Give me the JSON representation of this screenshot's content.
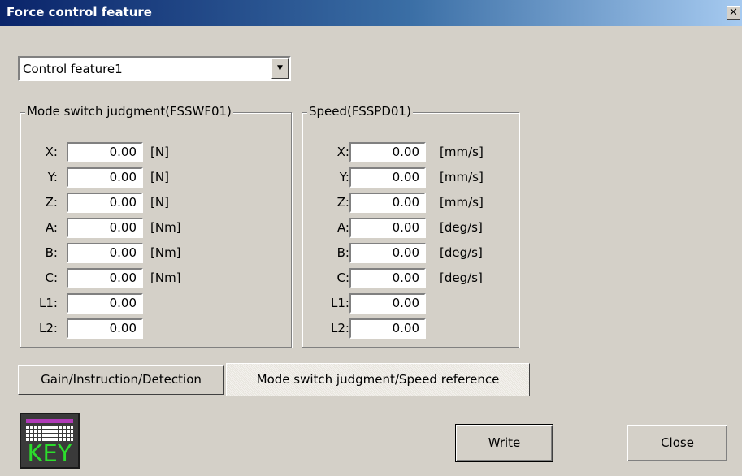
{
  "window": {
    "title": "Force control feature",
    "close_glyph": "✕"
  },
  "selector": {
    "value": "Control feature1",
    "arrow_icon": "▼"
  },
  "groups": {
    "mode_switch": {
      "title": "Mode switch judgment(FSSWF01)",
      "rows": [
        {
          "label": "X:",
          "value": "0.00",
          "unit": "[N]"
        },
        {
          "label": "Y:",
          "value": "0.00",
          "unit": "[N]"
        },
        {
          "label": "Z:",
          "value": "0.00",
          "unit": "[N]"
        },
        {
          "label": "A:",
          "value": "0.00",
          "unit": "[Nm]"
        },
        {
          "label": "B:",
          "value": "0.00",
          "unit": "[Nm]"
        },
        {
          "label": "C:",
          "value": "0.00",
          "unit": "[Nm]"
        },
        {
          "label": "L1:",
          "value": "0.00",
          "unit": ""
        },
        {
          "label": "L2:",
          "value": "0.00",
          "unit": ""
        }
      ]
    },
    "speed": {
      "title": "Speed(FSSPD01)",
      "rows": [
        {
          "label": "X:",
          "value": "0.00",
          "unit": "[mm/s]"
        },
        {
          "label": "Y:",
          "value": "0.00",
          "unit": "[mm/s]"
        },
        {
          "label": "Z:",
          "value": "0.00",
          "unit": "[mm/s]"
        },
        {
          "label": "A:",
          "value": "0.00",
          "unit": "[deg/s]"
        },
        {
          "label": "B:",
          "value": "0.00",
          "unit": "[deg/s]"
        },
        {
          "label": "C:",
          "value": "0.00",
          "unit": "[deg/s]"
        },
        {
          "label": "L1:",
          "value": "0.00",
          "unit": ""
        },
        {
          "label": "L2:",
          "value": "0.00",
          "unit": ""
        }
      ]
    }
  },
  "tabs": [
    {
      "label": "Gain/Instruction/Detection",
      "active": false
    },
    {
      "label": "Mode switch judgment/Speed reference",
      "active": true
    }
  ],
  "key_icon": {
    "text": "KEY",
    "icon": "keyboard-icon"
  },
  "buttons": {
    "write": "Write",
    "close": "Close"
  },
  "colors": {
    "title_start": "#0a246a",
    "title_end": "#a6caf0",
    "key_text": "#2cdd2c",
    "key_strip": "#b03ab8"
  }
}
